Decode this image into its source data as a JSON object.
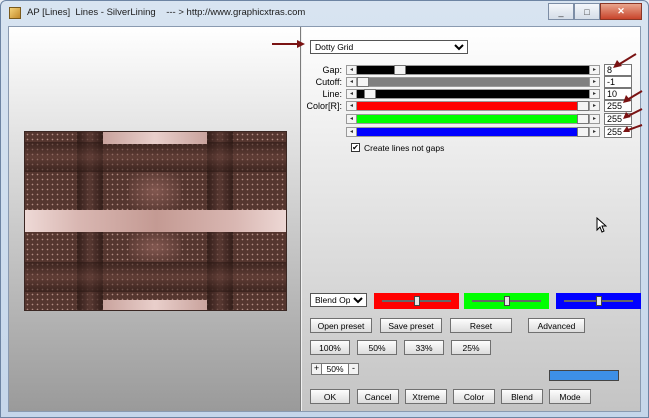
{
  "window": {
    "title": "AP [Lines]  Lines - SilverLining    --- > http://www.graphicxtras.com"
  },
  "preset": {
    "selected": "Dotty Grid"
  },
  "params": [
    {
      "label": "Gap:",
      "value": "8",
      "fraction": 0.17,
      "color": "#000000"
    },
    {
      "label": "Cutoff:",
      "value": "-1",
      "fraction": 0.0,
      "color": "#808080"
    },
    {
      "label": "Line:",
      "value": "10",
      "fraction": 0.03,
      "color": "#000000"
    },
    {
      "label": "Color[R]:",
      "value": "255",
      "fraction": 1.0,
      "color": "#ff0000"
    },
    {
      "label": "",
      "value": "255",
      "fraction": 1.0,
      "color": "#00ff00"
    },
    {
      "label": "",
      "value": "255",
      "fraction": 1.0,
      "color": "#0000ff"
    }
  ],
  "options": {
    "create_lines_label": "Create lines not gaps",
    "create_lines_checked": true
  },
  "blend": {
    "selected": "Blend Optio"
  },
  "color_sliders": [
    {
      "name": "red",
      "color": "#ff0000",
      "fraction": 0.5
    },
    {
      "name": "green",
      "color": "#00ff00",
      "fraction": 0.5
    },
    {
      "name": "blue",
      "color": "#0000ff",
      "fraction": 0.5
    }
  ],
  "buttons": {
    "open_preset": "Open preset",
    "save_preset": "Save preset",
    "reset": "Reset",
    "advanced": "Advanced",
    "zoom_100": "100%",
    "zoom_50": "50%",
    "zoom_33": "33%",
    "zoom_25": "25%",
    "ok": "OK",
    "cancel": "Cancel",
    "xtreme": "Xtreme",
    "color": "Color",
    "blend": "Blend",
    "mode": "Mode"
  },
  "zoom": {
    "minus": "-",
    "plus": "+",
    "value": "50%"
  },
  "color_swatch": "#3d8fe6",
  "window_buttons": {
    "minimize": "_",
    "maximize": "□",
    "close": "✕"
  }
}
